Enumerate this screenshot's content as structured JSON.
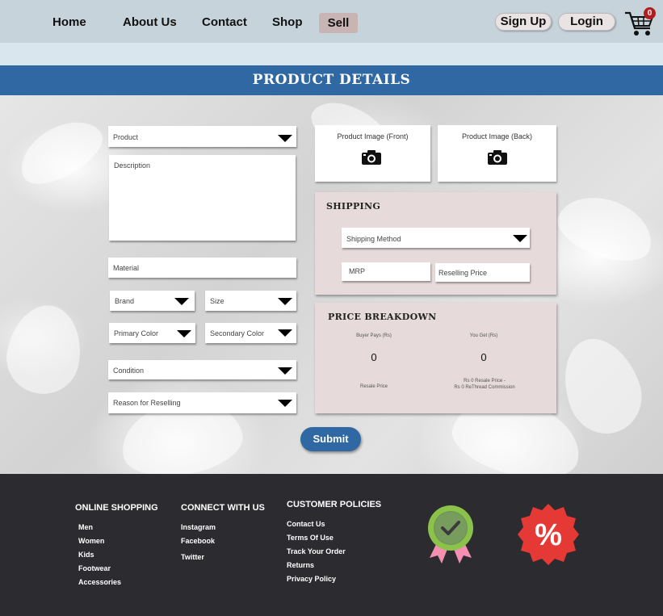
{
  "nav": {
    "home": "Home",
    "about": "About Us",
    "contact": "Contact",
    "shop": "Shop",
    "sell": "Sell",
    "signup": "Sign Up",
    "login": "Login",
    "cart_count": "0",
    "cart_icon": "shopping-cart-icon"
  },
  "page_title": "PRODUCT DETAILS",
  "form": {
    "product": "Product",
    "description": "Description",
    "material": "Material",
    "brand": "Brand",
    "size": "Size",
    "primary_color": "Primary Color",
    "secondary_color": "Secondary Color",
    "condition": "Condition",
    "reason": "Reason for Reselling",
    "image_front": "Product Image (Front)",
    "image_back": "Product Image (Back)",
    "camera_icon": "camera-icon",
    "submit": "Submit"
  },
  "shipping": {
    "title": "SHIPPING",
    "method": "Shipping Method",
    "mrp": "MRP",
    "reselling_price": "Reselling Price"
  },
  "price_breakdown": {
    "title": "PRICE BREAKDOWN",
    "buyer_pays_label": "Buyer Pays (Rs)",
    "you_get_label": "You Get (Rs)",
    "buyer_pays_value": "0",
    "you_get_value": "0",
    "resale_price_note": "Resale Price",
    "you_get_note_1": "Rs 0 Resale Price -",
    "you_get_note_2": "Rs 0 ReThread Commission"
  },
  "footer": {
    "online_shopping": {
      "title": "ONLINE SHOPPING",
      "items": [
        "Men",
        "Women",
        "Kids",
        "Footwear",
        "Accessories"
      ]
    },
    "connect": {
      "title": "CONNECT WITH US",
      "items": [
        "Instagram",
        "Facebook",
        "Twitter"
      ]
    },
    "policies": {
      "title": "CUSTOMER POLICIES",
      "items": [
        "Contact Us",
        "Terms Of Use",
        "Track Your Order",
        "Returns",
        "Privacy Policy"
      ]
    },
    "badge_icon": "quality-badge-icon",
    "discount_icon": "discount-percent-icon",
    "discount_symbol": "%"
  },
  "colors": {
    "primary": "#2f68a2",
    "nav_bg": "#c7d3db",
    "footer_bg": "#2c2c30",
    "panel_bg": "#e6dada",
    "discount_red": "#e53935",
    "badge_green": "#8bc34a"
  }
}
